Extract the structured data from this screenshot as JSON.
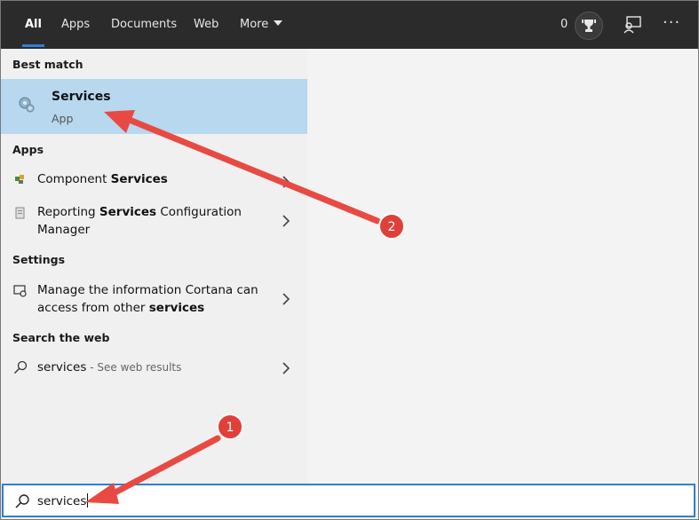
{
  "tabs": [
    {
      "label": "All"
    },
    {
      "label": "Apps"
    },
    {
      "label": "Documents"
    },
    {
      "label": "Web"
    },
    {
      "label": "More"
    }
  ],
  "topbar": {
    "points": "0",
    "icons": [
      "trophy-icon",
      "feedback-icon",
      "more-options-icon"
    ]
  },
  "sections": {
    "best_match": "Best match",
    "apps": "Apps",
    "settings": "Settings",
    "search_web": "Search the web"
  },
  "best_match": {
    "title": "Services",
    "subtitle": "App",
    "icon": "services-gear-icon"
  },
  "apps": [
    {
      "pre": "Component ",
      "bold": "Services",
      "post": "",
      "line2": ""
    },
    {
      "pre": "Reporting ",
      "bold": "Services",
      "post": " Configuration",
      "line2": "Manager"
    }
  ],
  "settings": [
    {
      "line1": "Manage the information Cortana can",
      "pre2": "access from other ",
      "bold2": "services"
    }
  ],
  "web": {
    "query": "services",
    "hint": " - See web results"
  },
  "search": {
    "value": "services"
  },
  "annotations": [
    {
      "label": "1"
    },
    {
      "label": "2"
    }
  ],
  "colors": {
    "topbar": "#2b2b2b",
    "selected": "#b7d8ee",
    "accent": "#2f7fd3",
    "arrow": "#e84a43"
  }
}
